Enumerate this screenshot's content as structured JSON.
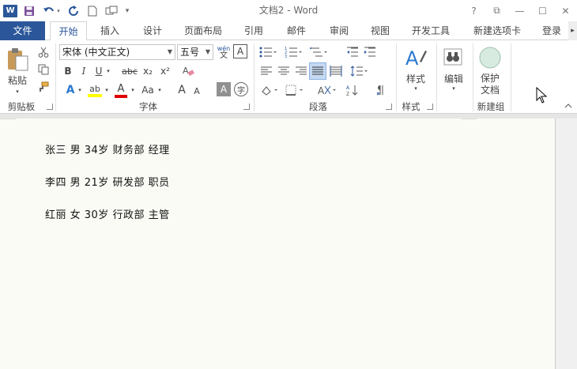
{
  "app": {
    "title": "文档2 - Word",
    "logo_letter": "W"
  },
  "window_controls": [
    "?",
    "⧉",
    "—",
    "☐",
    "✕"
  ],
  "tabs": {
    "file": "文件",
    "items": [
      "开始",
      "插入",
      "设计",
      "页面布局",
      "引用",
      "邮件",
      "审阅",
      "视图",
      "开发工具",
      "新建选项卡"
    ],
    "active": "开始",
    "login": "登录"
  },
  "ribbon": {
    "clipboard": {
      "paste": "粘贴",
      "label": "剪贴板"
    },
    "font": {
      "font_name": "宋体 (中文正文)",
      "font_size": "五号",
      "pinyin": "wén",
      "bold": "B",
      "italic": "I",
      "underline": "U",
      "strike": "abc",
      "subscript": "x₂",
      "superscript": "x²",
      "text_effect": "A",
      "highlight": "ab",
      "font_color": "A",
      "change_case": "Aa",
      "grow": "A",
      "shrink": "A",
      "char_shading": "A",
      "enclose": "字",
      "border_char": "A",
      "label": "字体"
    },
    "paragraph": {
      "label": "段落"
    },
    "styles": {
      "button": "样式",
      "label": "样式"
    },
    "editing": {
      "button": "编辑"
    },
    "new_group": {
      "button_line1": "保护",
      "button_line2": "文档",
      "label": "新建组"
    },
    "colors": {
      "highlight": "#ffff00",
      "font_color": "#e00000",
      "accent": "#2b579a"
    }
  },
  "document": {
    "lines": [
      "张三 男 34岁 财务部 经理",
      "李四 男 21岁 研发部 职员",
      "红丽 女 30岁 行政部 主管"
    ]
  }
}
